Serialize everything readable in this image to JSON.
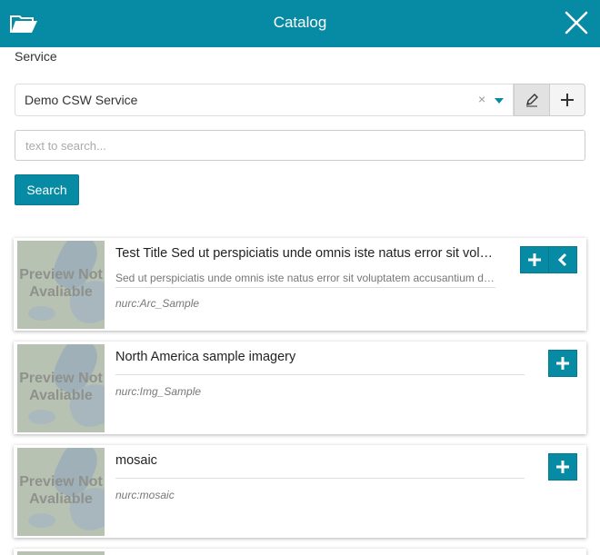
{
  "header": {
    "title": "Catalog",
    "icons": {
      "left": "folder-open-icon",
      "right": "close-icon"
    }
  },
  "service": {
    "label": "Service",
    "selected": "Demo CSW Service",
    "clear_glyph": "×",
    "edit_icon": "pencil-icon",
    "add_icon": "plus-icon"
  },
  "search": {
    "placeholder": "text to search...",
    "value": "",
    "button_label": "Search"
  },
  "records": [
    {
      "title": "Test Title Sed ut perspiciatis unde omnis iste natus error sit voluptatem accusantium",
      "description": "Sed ut perspiciatis unde omnis iste natus error sit voluptatem accusantium doloremque laudantium",
      "identifier": "nurc:Arc_Sample",
      "preview_text": "Preview Not Avaliable",
      "actions": [
        "add-layer",
        "collapse"
      ]
    },
    {
      "title": "North America sample imagery",
      "description": "",
      "identifier": "nurc:Img_Sample",
      "preview_text": "Preview Not Avaliable",
      "actions": [
        "add-layer"
      ]
    },
    {
      "title": "mosaic",
      "description": "",
      "identifier": "nurc:mosaic",
      "preview_text": "Preview Not Avaliable",
      "actions": [
        "add-layer"
      ]
    }
  ],
  "colors": {
    "accent": "#078aa3",
    "header_text": "#ffffff"
  }
}
